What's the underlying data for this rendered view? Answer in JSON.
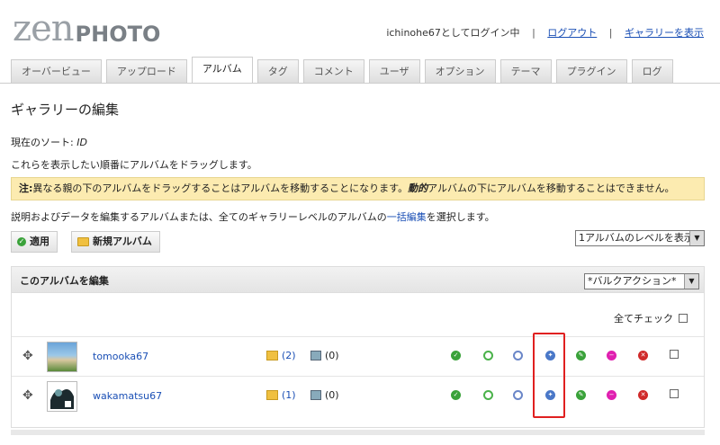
{
  "logo": {
    "zen": "zen",
    "photo": "PHOTO"
  },
  "userbar": {
    "login_text": "ichinohe67としてログイン中",
    "sep": "|",
    "logout": "ログアウト",
    "view_gallery": "ギャラリーを表示"
  },
  "tabs": [
    {
      "label": "オーバービュー",
      "active": false
    },
    {
      "label": "アップロード",
      "active": false
    },
    {
      "label": "アルバム",
      "active": true
    },
    {
      "label": "タグ",
      "active": false
    },
    {
      "label": "コメント",
      "active": false
    },
    {
      "label": "ユーザ",
      "active": false
    },
    {
      "label": "オプション",
      "active": false
    },
    {
      "label": "テーマ",
      "active": false
    },
    {
      "label": "プラグイン",
      "active": false
    },
    {
      "label": "ログ",
      "active": false
    }
  ],
  "page": {
    "title": "ギャラリーの編集",
    "sort_label": "現在のソート: ",
    "sort_value": "ID",
    "drag_text": "これらを表示したい順番にアルバムをドラッグします。",
    "notice_prefix": "注:",
    "notice_text1": "異なる親の下のアルバムをドラッグすることはアルバムを移動することになります。",
    "notice_bold": "動的",
    "notice_text2": "アルバムの下にアルバムを移動することはできません。",
    "desc_text1": "説明およびデータを編集するアルバムまたは、全てのギャラリーレベルのアルバムの",
    "desc_link": "一括編集",
    "desc_text2": "を選択します。",
    "apply_button": "適用",
    "new_album_button": "新規アルバム",
    "levels_select": "1アルバムのレベルを表示",
    "panel_title": "このアルバムを編集",
    "bulk_select": "*バルクアクション*",
    "check_all": "全てチェック"
  },
  "albums": [
    {
      "name": "tomooka67",
      "subalbums": "(2)",
      "images": "(0)"
    },
    {
      "name": "wakamatsu67",
      "subalbums": "(1)",
      "images": "(0)"
    }
  ],
  "colors": {
    "accent_link": "#1a4fb5",
    "notice_bg": "#fcebb0",
    "highlight": "#e02020"
  }
}
